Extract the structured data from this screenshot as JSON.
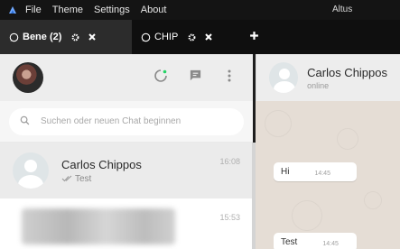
{
  "menubar": {
    "items": [
      "File",
      "Theme",
      "Settings",
      "About"
    ],
    "window_title": "Altus"
  },
  "tabs": [
    {
      "label": "Bene (2)",
      "active": true
    },
    {
      "label": "CHIP",
      "active": false
    }
  ],
  "sidebar": {
    "search_placeholder": "Suchen oder neuen Chat beginnen",
    "chats": [
      {
        "name": "Carlos Chippos",
        "preview": "Test",
        "time": "16:08",
        "selected": true
      },
      {
        "name": "",
        "preview": "",
        "time": "15:53",
        "selected": false
      }
    ]
  },
  "conversation": {
    "contact_name": "Carlos Chippos",
    "status": "online",
    "messages": [
      {
        "text": "Hi",
        "time": "14:45"
      },
      {
        "text": "Test",
        "time": "14:45"
      }
    ]
  },
  "colors": {
    "accent_green": "#25d366",
    "chat_bg": "#e5ddd5"
  }
}
